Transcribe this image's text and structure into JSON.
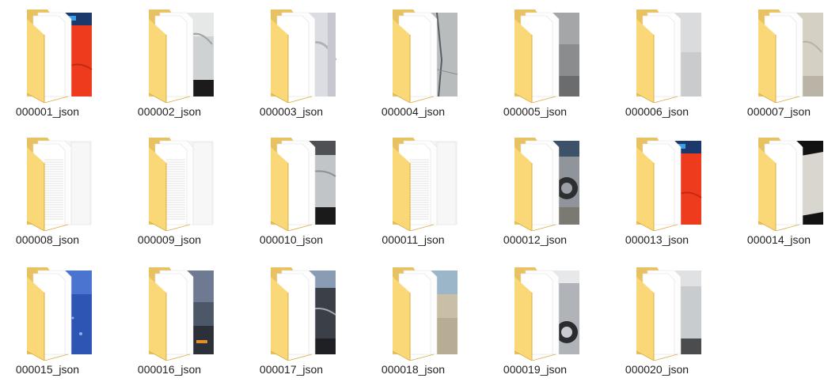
{
  "files": [
    {
      "name": "000001_json",
      "preview": "red-car"
    },
    {
      "name": "000002_json",
      "preview": "silver-door"
    },
    {
      "name": "000003_json",
      "preview": "white-bumper"
    },
    {
      "name": "000004_json",
      "preview": "scratched-panel"
    },
    {
      "name": "000005_json",
      "preview": "grey-panel"
    },
    {
      "name": "000006_json",
      "preview": "light-grey-panel"
    },
    {
      "name": "000007_json",
      "preview": "beige-panel"
    },
    {
      "name": "000008_json",
      "preview": "document"
    },
    {
      "name": "000009_json",
      "preview": "document"
    },
    {
      "name": "000010_json",
      "preview": "silver-car-side"
    },
    {
      "name": "000011_json",
      "preview": "document"
    },
    {
      "name": "000012_json",
      "preview": "car-wheel"
    },
    {
      "name": "000013_json",
      "preview": "red-car"
    },
    {
      "name": "000014_json",
      "preview": "white-car-dark"
    },
    {
      "name": "000015_json",
      "preview": "blue-panel"
    },
    {
      "name": "000016_json",
      "preview": "night-road"
    },
    {
      "name": "000017_json",
      "preview": "dark-car-side"
    },
    {
      "name": "000018_json",
      "preview": "sand-blur"
    },
    {
      "name": "000019_json",
      "preview": "silver-car-wheel"
    },
    {
      "name": "000020_json",
      "preview": "silver-car-rear"
    }
  ],
  "colors": {
    "folder_back": "#e8c260",
    "folder_front": "#fad877",
    "folder_edge": "#d9ad45",
    "label_text": "#1f1f1f"
  }
}
